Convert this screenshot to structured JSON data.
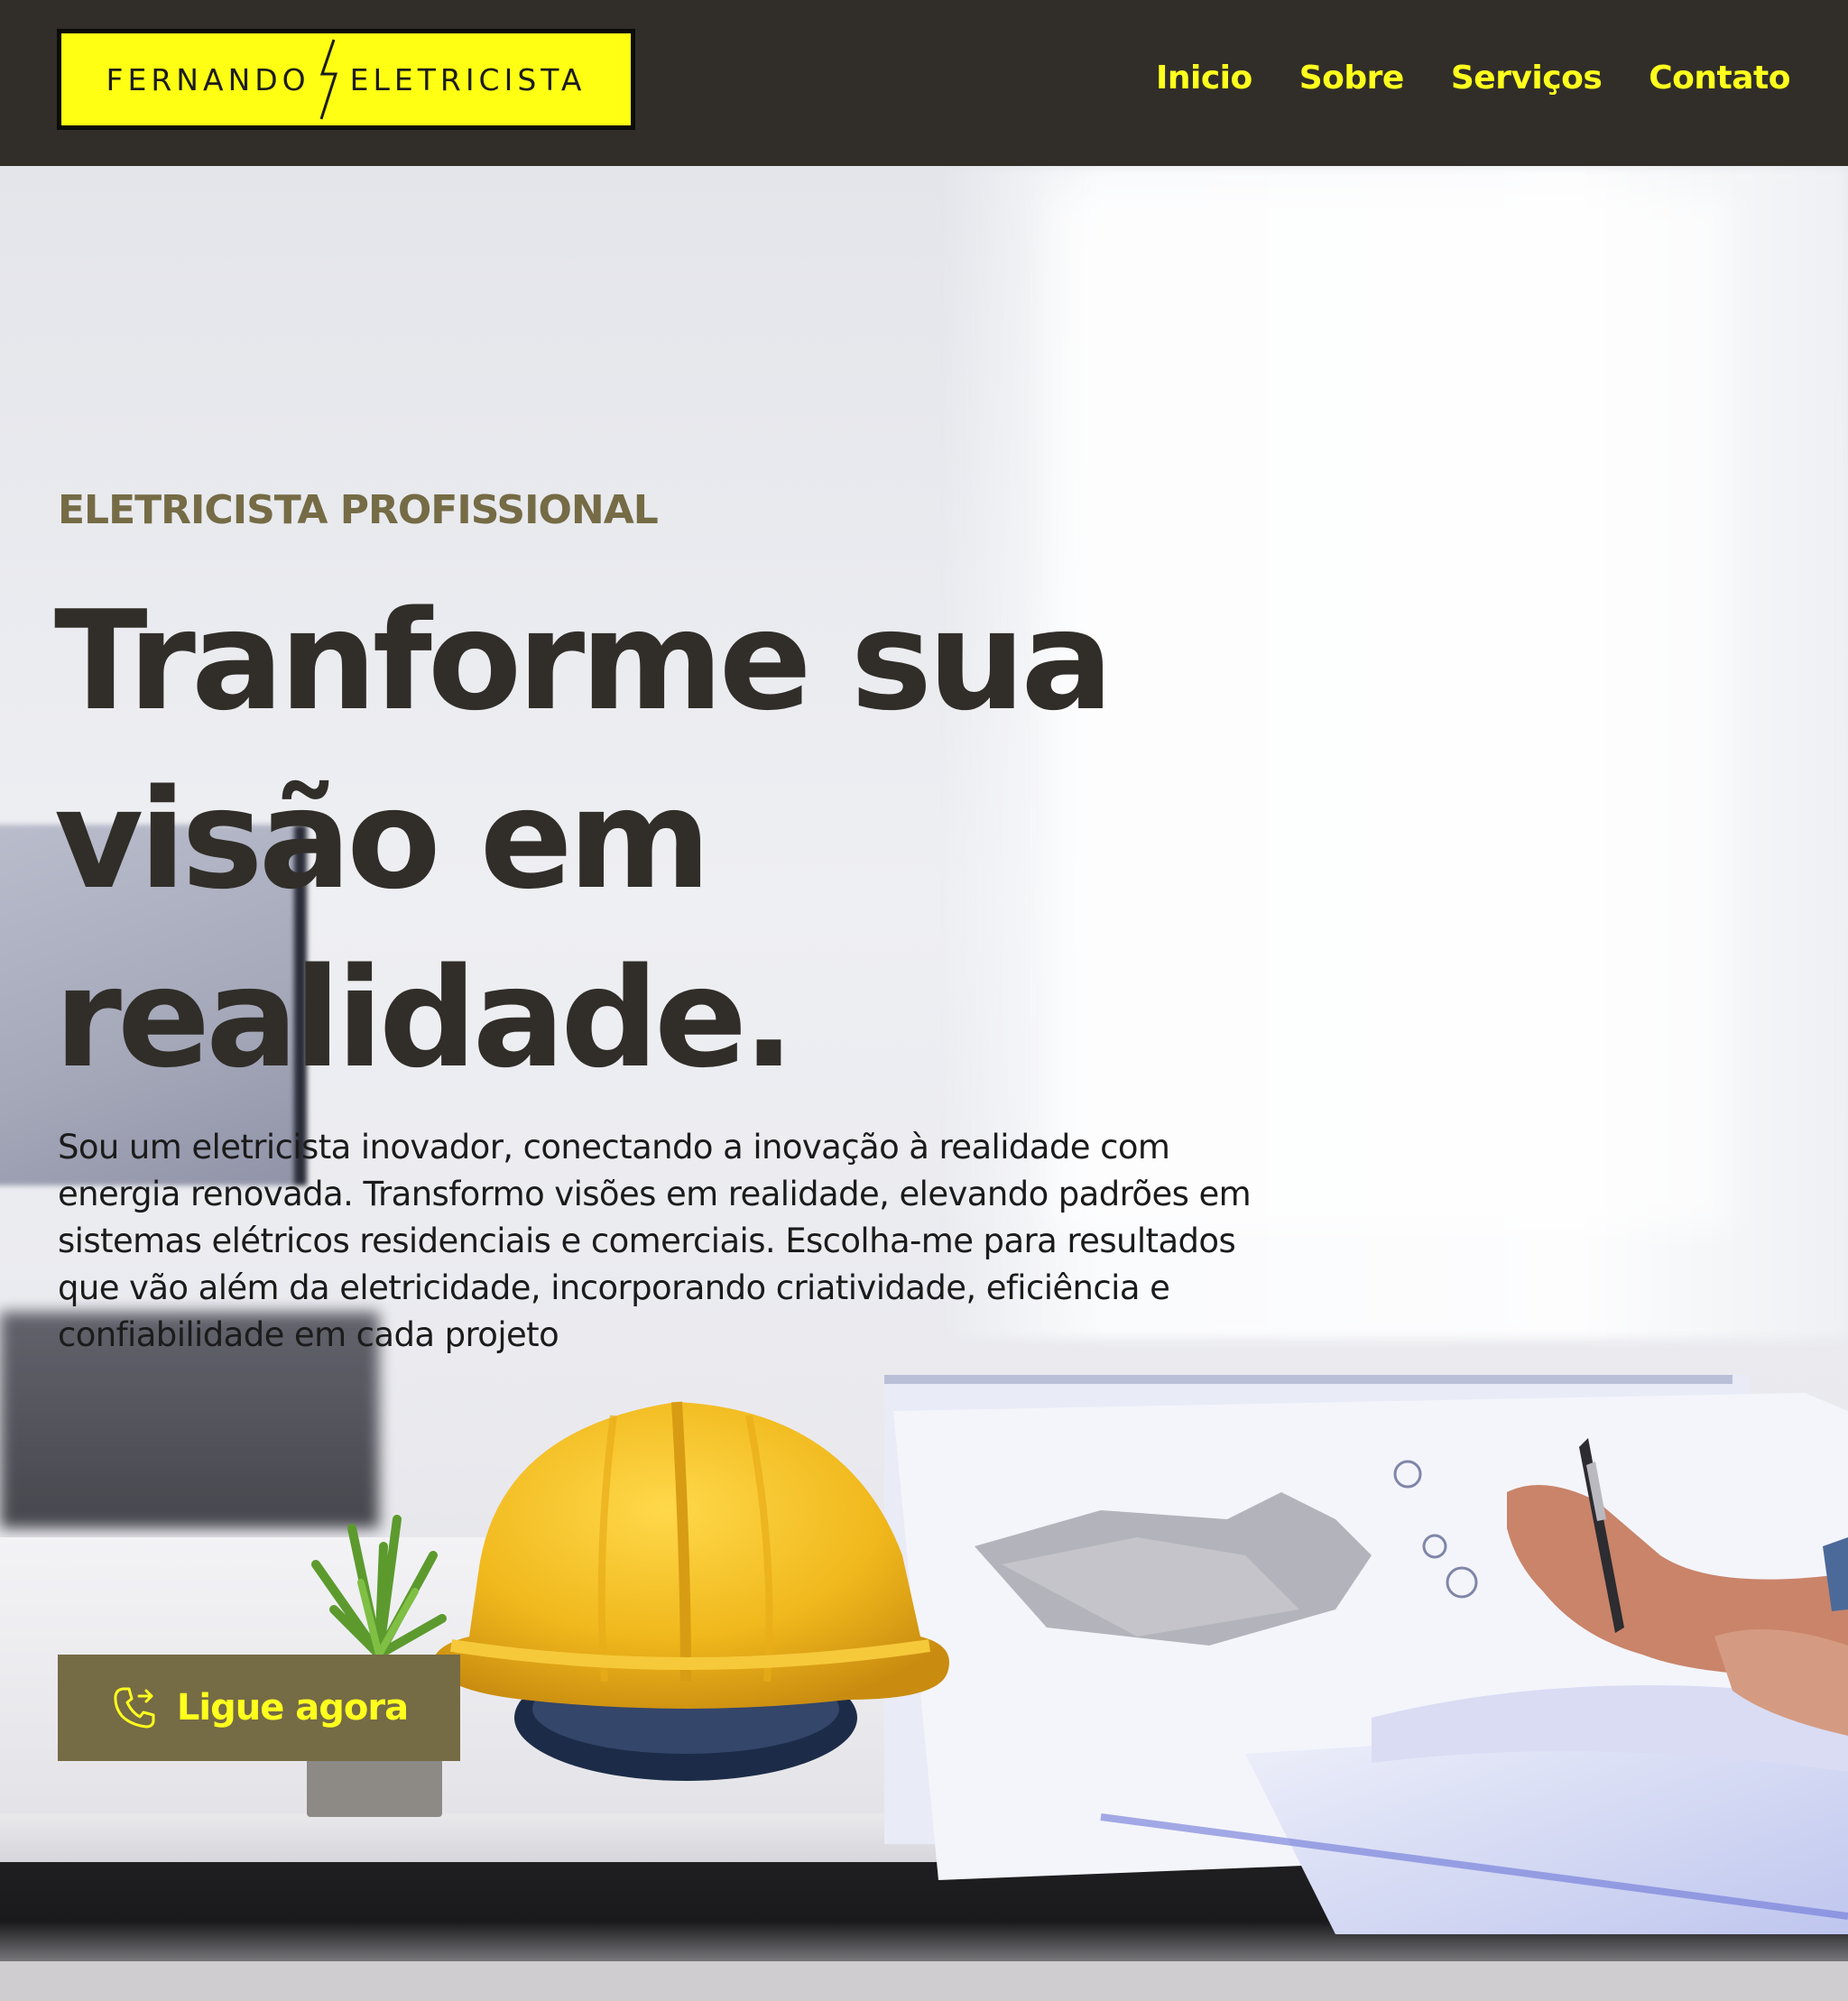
{
  "header": {
    "logo_left": "FERNANDO",
    "logo_right": "ELETRICISTA",
    "nav": [
      {
        "label": "Inicio"
      },
      {
        "label": "Sobre"
      },
      {
        "label": "Serviços"
      },
      {
        "label": "Contato"
      }
    ]
  },
  "hero": {
    "eyebrow": "ELETRICISTA PROFISSIONAL",
    "headline": "Tranforme sua visão em realidade.",
    "description": "Sou um eletricista inovador, conectando a inovação à realidade com energia renovada. Transformo visões em realidade, elevando padrões em sistemas elétricos residenciais e comerciais. Escolha-me para resultados que vão além da eletricidade, incorporando criatividade, eficiência e confiabilidade em cada projeto",
    "cta_label": "Ligue agora",
    "cta_icon": "phone-outgoing-icon"
  },
  "colors": {
    "header_bg": "#312e29",
    "nav_text": "#ffff1e",
    "logo_bg": "#ffff14",
    "accent_olive": "#756b45",
    "headline_text": "#312e29"
  }
}
